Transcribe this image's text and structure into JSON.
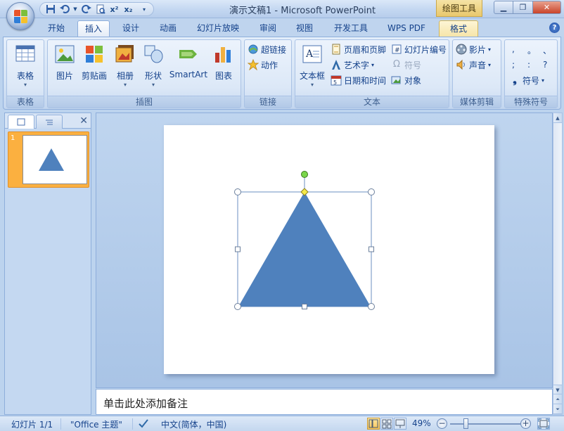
{
  "window": {
    "title": "演示文稿1 - Microsoft PowerPoint",
    "contextual_tool": "绘图工具"
  },
  "tabs": [
    {
      "label": "开始"
    },
    {
      "label": "插入"
    },
    {
      "label": "设计"
    },
    {
      "label": "动画"
    },
    {
      "label": "幻灯片放映"
    },
    {
      "label": "审阅"
    },
    {
      "label": "视图"
    },
    {
      "label": "开发工具"
    },
    {
      "label": "WPS PDF"
    },
    {
      "label": "格式"
    }
  ],
  "active_tab": "插入",
  "ribbon": {
    "groups": {
      "tables": "表格",
      "illustrations": "插图",
      "links": "链接",
      "text": "文本",
      "media": "媒体剪辑",
      "special": "特殊符号"
    },
    "buttons": {
      "table": "表格",
      "picture": "图片",
      "clipart": "剪贴画",
      "album": "相册",
      "shapes": "形状",
      "smartart": "SmartArt",
      "chart": "图表",
      "hyperlink": "超链接",
      "action": "动作",
      "textbox": "文本框",
      "header_footer": "页眉和页脚",
      "wordart": "艺术字",
      "datetime": "日期和时间",
      "slide_number": "幻灯片编号",
      "symbol": "符号",
      "object": "对象",
      "movie": "影片",
      "sound": "声音",
      "special_symbol": "符号"
    },
    "special_chars": [
      ",",
      "。",
      "、",
      ";",
      ":",
      "?"
    ]
  },
  "slides_panel": {
    "slide_number": "1"
  },
  "notes_placeholder": "单击此处添加备注",
  "status": {
    "slide_indicator": "幻灯片 1/1",
    "theme": "\"Office 主题\"",
    "language": "中文(简体，中国)",
    "zoom": "49%",
    "zoom_fraction": 0.49
  },
  "shape": {
    "type": "isosceles-triangle",
    "fill": "#4f81bd",
    "selected": true
  },
  "colors": {
    "accent": "#15428b",
    "shape_fill": "#4f81bd",
    "selection_handle_rotate": "#7ad64a",
    "selection_handle_adjust": "#f5e94a"
  }
}
